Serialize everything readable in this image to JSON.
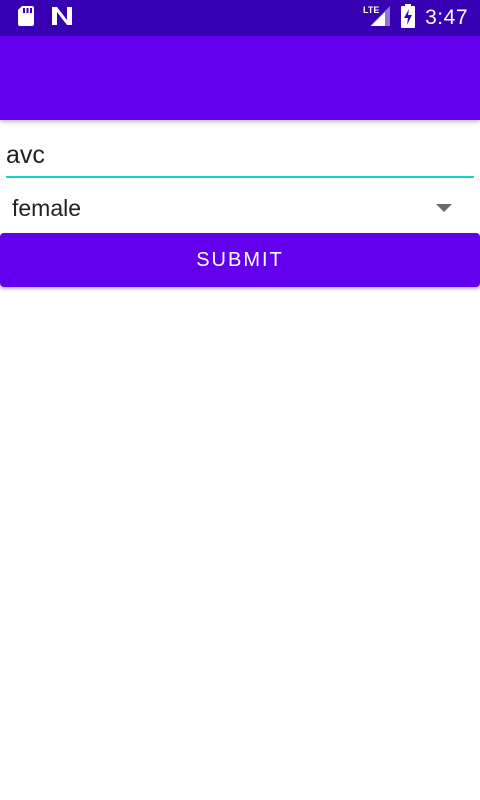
{
  "status_bar": {
    "time": "3:47",
    "network": "LTE",
    "icons": [
      "sd-card-icon",
      "n-notification-icon",
      "lte-signal-icon",
      "battery-charging-icon"
    ],
    "background": "#3700b3"
  },
  "app_bar": {
    "background": "#6200ee"
  },
  "form": {
    "name_input_value": "avc",
    "gender_selected": "female",
    "submit_label": "SUBMIT",
    "accent": "#16d2c2"
  }
}
